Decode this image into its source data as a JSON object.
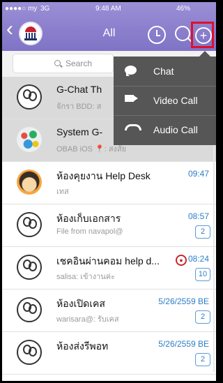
{
  "status_bar": {
    "carrier": "●●●●○ my",
    "network": "3G",
    "time": "9:48 AM",
    "battery": "46%"
  },
  "header": {
    "title": "All"
  },
  "search": {
    "placeholder": "Search"
  },
  "popup_menu": [
    {
      "label": "Chat",
      "icon": "chat-bubble-icon"
    },
    {
      "label": "Video Call",
      "icon": "video-camera-icon"
    },
    {
      "label": "Audio Call",
      "icon": "phone-icon"
    }
  ],
  "chats": [
    {
      "name": "G-Chat Th",
      "subtitle": "จักรา BDD: ส",
      "time": "",
      "badge": "",
      "avatar": "group-outline",
      "dim": true
    },
    {
      "name": "System G-",
      "subtitle": "OBAB iOS 📍: สงสัย",
      "time": "",
      "badge": "",
      "avatar": "colorful",
      "dim": true
    },
    {
      "name": "ห้องคุยงาน Help Desk",
      "subtitle": "เทส",
      "time": "09:47",
      "badge": "",
      "avatar": "cartoon",
      "dim": false
    },
    {
      "name": "ห้องเก็บเอกสาร",
      "subtitle": "File from navapol@",
      "time": "08:57",
      "badge": "2",
      "avatar": "group-outline",
      "dim": false
    },
    {
      "name": "เชคอินผ่านคอม help d...",
      "subtitle": "salisa: เข้างานค่ะ",
      "time": "08:24",
      "badge": "10",
      "avatar": "group-outline",
      "dim": false,
      "pin": "location-pin-icon"
    },
    {
      "name": "ห้องเปิดเคส",
      "subtitle": "warisara@: รับเคส",
      "time": "5/26/2559 BE",
      "badge": "2",
      "avatar": "group-outline",
      "dim": false
    },
    {
      "name": "ห้องส่งรีพอท",
      "subtitle": "",
      "time": "5/26/2559 BE",
      "badge": "2",
      "avatar": "group-outline",
      "dim": false
    }
  ]
}
